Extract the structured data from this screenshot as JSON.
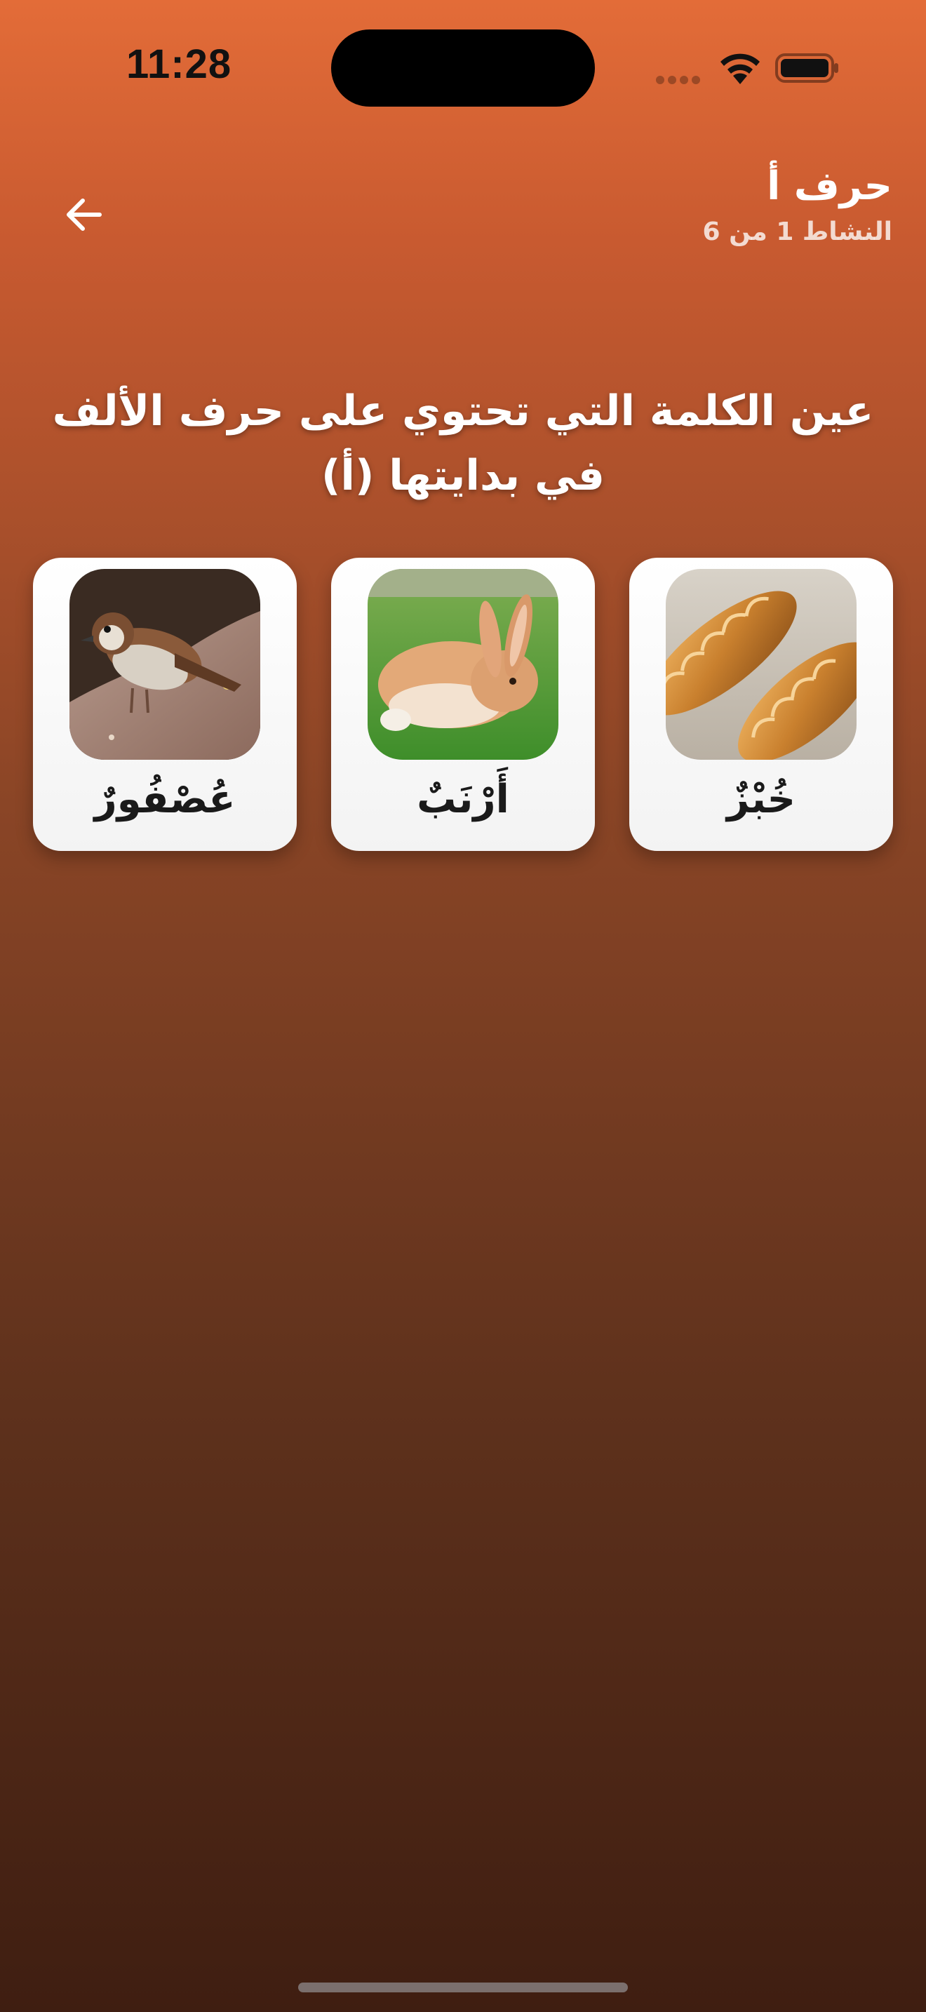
{
  "status_bar": {
    "time": "11:28"
  },
  "header": {
    "title": "حرف أ",
    "subtitle": "النشاط 1 من 6",
    "back_icon": "arrow-left-icon"
  },
  "question": {
    "text": "عين الكلمة التي تحتوي على حرف الألف في بدايتها (أ)"
  },
  "options": [
    {
      "label": "خُبْزٌ",
      "image": "bread-image"
    },
    {
      "label": "أَرْنَبٌ",
      "image": "rabbit-image"
    },
    {
      "label": "عُصْفُورٌ",
      "image": "sparrow-image"
    }
  ],
  "colors": {
    "background_top": "#e36c38",
    "background_bottom": "#3f1e11",
    "card": "#ffffff",
    "text": "#ffffff",
    "label_text": "#1a1a1a"
  }
}
